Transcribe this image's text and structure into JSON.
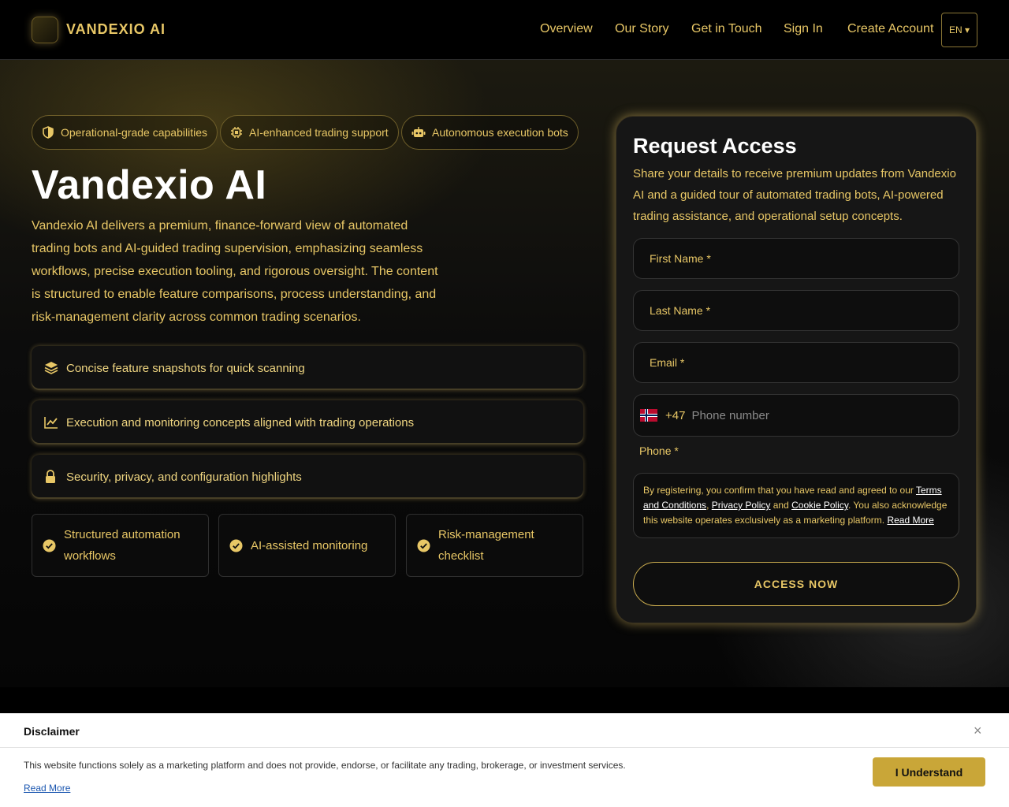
{
  "header": {
    "brand": "VANDEXIO AI",
    "nav": [
      "Overview",
      "Our Story",
      "Get in Touch",
      "Sign In",
      "Create Account"
    ],
    "language": "EN ▾"
  },
  "hero": {
    "pills": [
      {
        "label": "Operational-grade capabilities",
        "icon": "shield-icon"
      },
      {
        "label": "AI-enhanced trading support",
        "icon": "chip-icon"
      },
      {
        "label": "Autonomous execution bots",
        "icon": "robot-icon"
      }
    ],
    "title": "Vandexio AI",
    "description": "Vandexio AI delivers a premium, finance-forward view of automated trading bots and AI-guided trading supervision, emphasizing seamless workflows, precise execution tooling, and rigorous oversight. The content is structured to enable feature comparisons, process understanding, and risk-management clarity across common trading scenarios.",
    "features": [
      {
        "label": "Concise feature snapshots for quick scanning",
        "icon": "layers-icon"
      },
      {
        "label": "Execution and monitoring concepts aligned with trading operations",
        "icon": "chart-line-icon"
      },
      {
        "label": "Security, privacy, and configuration highlights",
        "icon": "lock-icon"
      }
    ],
    "checks": [
      {
        "label": "Structured automation workflows"
      },
      {
        "label": "AI-assisted monitoring"
      },
      {
        "label": "Risk-management checklist"
      }
    ]
  },
  "form": {
    "title": "Request Access",
    "subtitle": "Share your details to receive premium updates from Vandexio AI and a guided tour of automated trading bots, AI-powered trading assistance, and operational setup concepts.",
    "first_name": "First Name *",
    "last_name": "Last Name *",
    "email": "Email *",
    "dial_code": "+47",
    "phone_placeholder": "Phone number",
    "phone_label": "Phone *",
    "terms": {
      "prefix": "By registering, you confirm that you have read and agreed to our ",
      "terms_link": "Terms and Conditions",
      "sep1": ", ",
      "privacy_link": "Privacy Policy",
      "sep2": " and ",
      "cookie_link": "Cookie Policy",
      "suffix": ". You also acknowledge this website operates exclusively as a marketing platform. ",
      "read_more": "Read More"
    },
    "submit": "ACCESS NOW"
  },
  "disclaimer": {
    "title": "Disclaimer",
    "close": "×",
    "text": "This website functions solely as a marketing platform and does not provide, endorse, or facilitate any trading, brokerage, or investment services.",
    "read_more": "Read More",
    "button": "I Understand"
  },
  "colors": {
    "accent": "#e8c766",
    "button_gold": "#c9a638",
    "background": "#000000"
  }
}
